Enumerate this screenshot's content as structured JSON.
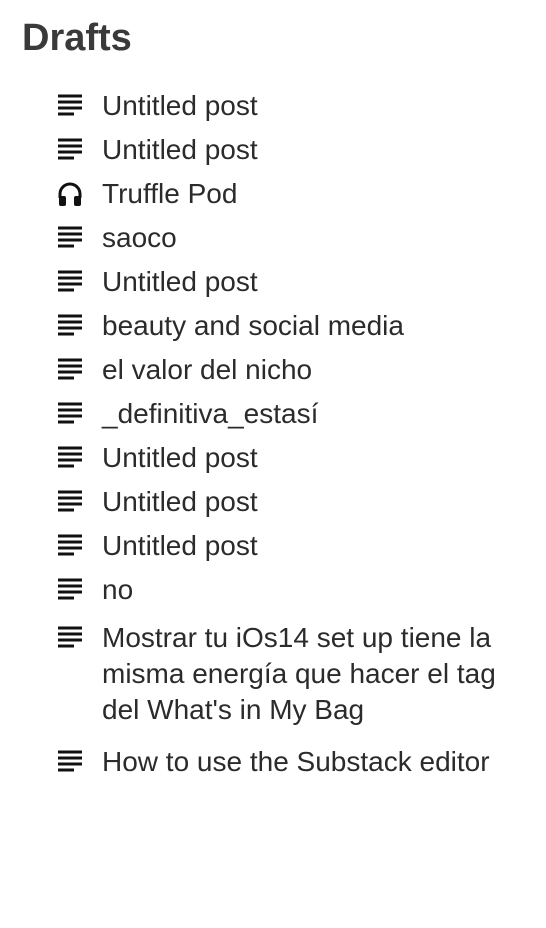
{
  "header": {
    "title": "Drafts"
  },
  "drafts": [
    {
      "label": "Untitled post",
      "icon": "document-lines-icon"
    },
    {
      "label": "Untitled post",
      "icon": "document-lines-icon"
    },
    {
      "label": "Truffle Pod",
      "icon": "headphones-icon"
    },
    {
      "label": "saoco",
      "icon": "document-lines-icon"
    },
    {
      "label": "Untitled post",
      "icon": "document-lines-icon"
    },
    {
      "label": "beauty and social media",
      "icon": "document-lines-icon"
    },
    {
      "label": "el valor del nicho",
      "icon": "document-lines-icon"
    },
    {
      "label": "_definitiva_estasí",
      "icon": "document-lines-icon"
    },
    {
      "label": "Untitled post",
      "icon": "document-lines-icon"
    },
    {
      "label": "Untitled post",
      "icon": "document-lines-icon"
    },
    {
      "label": "Untitled post",
      "icon": "document-lines-icon"
    },
    {
      "label": "no",
      "icon": "document-lines-icon"
    },
    {
      "label": "Mostrar tu iOs14 set up tiene la misma energía que hacer el tag del What's in My Bag",
      "icon": "document-lines-icon"
    },
    {
      "label": "How to use the Substack editor",
      "icon": "document-lines-icon"
    }
  ]
}
